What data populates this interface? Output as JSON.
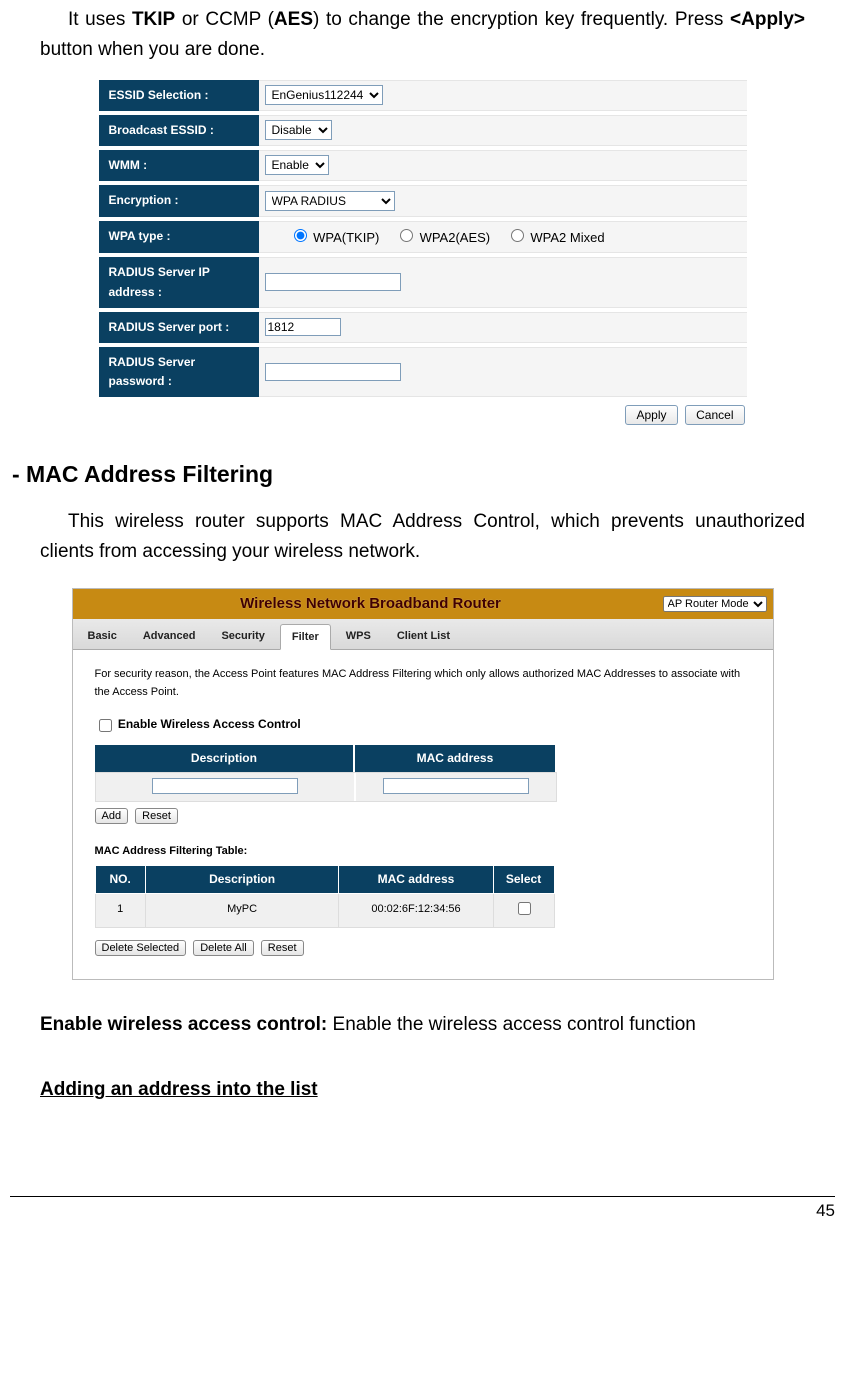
{
  "intro_para": {
    "prefix": "It uses ",
    "tkip": "TKIP",
    "mid1": " or CCMP (",
    "aes": "AES",
    "mid2": ") to change the encryption key frequently. Press ",
    "apply": "<Apply>",
    "suffix": " button when you are done."
  },
  "settings": {
    "rows": {
      "essid_sel_label": "ESSID Selection :",
      "essid_sel_value": "EnGenius112244",
      "broadcast_label": "Broadcast ESSID :",
      "broadcast_value": "Disable",
      "wmm_label": "WMM :",
      "wmm_value": "Enable",
      "encryption_label": "Encryption :",
      "encryption_value": "WPA RADIUS",
      "wpa_type_label": "WPA type :",
      "wpa_opt1": "WPA(TKIP)",
      "wpa_opt2": "WPA2(AES)",
      "wpa_opt3": "WPA2 Mixed",
      "radius_ip_label": "RADIUS Server IP address :",
      "radius_ip_value": "",
      "radius_port_label": "RADIUS Server port :",
      "radius_port_value": "1812",
      "radius_pw_label": "RADIUS Server password :",
      "radius_pw_value": ""
    },
    "buttons": {
      "apply": "Apply",
      "cancel": "Cancel"
    }
  },
  "heading_mac": "- MAC Address Filtering",
  "mac_para": "This  wireless  router  supports  MAC  Address  Control,  which  prevents unauthorized clients from accessing your wireless network.",
  "router": {
    "title": "Wireless Network Broadband Router",
    "mode": "AP Router Mode",
    "tabs": [
      "Basic",
      "Advanced",
      "Security",
      "Filter",
      "WPS",
      "Client List"
    ],
    "active_tab_index": 3,
    "desc": "For security reason, the Access Point features MAC Address Filtering which only allows authorized MAC Addresses to associate with the Access Point.",
    "enable_label": "Enable Wireless Access Control",
    "col_desc": "Description",
    "col_mac": "MAC address",
    "add_btn": "Add",
    "reset_btn": "Reset",
    "filter_title": "MAC Address Filtering Table:",
    "th_no": "NO.",
    "th_desc": "Description",
    "th_mac": "MAC address",
    "th_sel": "Select",
    "row_no": "1",
    "row_desc": "MyPC",
    "row_mac": "00:02:6F:12:34:56",
    "del_sel": "Delete Selected",
    "del_all": "Delete All",
    "reset2": "Reset"
  },
  "enable_line": {
    "label": "Enable wireless access control:",
    "text": " Enable the wireless access control function"
  },
  "adding_heading": "Adding an address into the list",
  "page_number": "45"
}
